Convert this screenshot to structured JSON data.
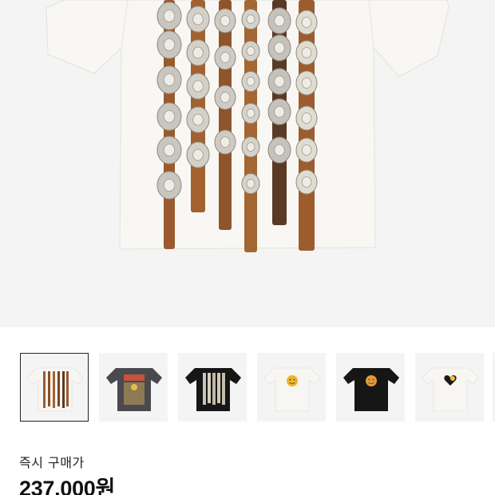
{
  "product": {
    "main_image_icon": "tshirt-concho-belt-print",
    "thumbnails": [
      {
        "icon": "tshirt-white-concho-belts",
        "shirt_color": "#f7f6f2",
        "selected": true
      },
      {
        "icon": "tshirt-charcoal-graphic",
        "shirt_color": "#4a4a4e",
        "selected": false
      },
      {
        "icon": "tshirt-black-concho-belts",
        "shirt_color": "#161616",
        "selected": false
      },
      {
        "icon": "tshirt-white-smiley",
        "shirt_color": "#f7f6f2",
        "selected": false
      },
      {
        "icon": "tshirt-black-smiley",
        "shirt_color": "#161616",
        "selected": false
      },
      {
        "icon": "tshirt-white-heart",
        "shirt_color": "#f7f6f2",
        "selected": false
      }
    ]
  },
  "pricing": {
    "instant_buy_label": "즉시 구매가",
    "instant_buy_price": "237,000원"
  },
  "colors": {
    "image_bg": "#f4f4f4",
    "text_primary": "#111111",
    "selected_border": "#222222"
  }
}
